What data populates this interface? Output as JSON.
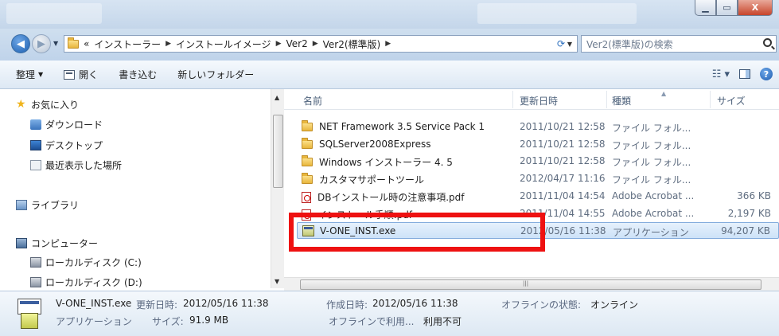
{
  "window": {
    "caption_buttons": [
      "minimize",
      "maximize",
      "close"
    ],
    "close_label": "X"
  },
  "address": {
    "overflow": "«",
    "crumbs": [
      "インストーラー",
      "インストールイメージ",
      "Ver2",
      "Ver2(標準版)"
    ],
    "search_placeholder": "Ver2(標準版)の検索"
  },
  "toolbar": {
    "organize": "整理",
    "open": "開く",
    "burn": "書き込む",
    "new_folder": "新しいフォルダー"
  },
  "nav": {
    "favorites": "お気に入り",
    "downloads": "ダウンロード",
    "desktop": "デスクトップ",
    "recent": "最近表示した場所",
    "libraries": "ライブラリ",
    "computer": "コンピューター",
    "local_c": "ローカルディスク (C:)",
    "local_d": "ローカルディスク (D:)"
  },
  "columns": {
    "name": "名前",
    "date": "更新日時",
    "type": "種類",
    "size": "サイズ"
  },
  "files": [
    {
      "name": "NET Framework 3.5 Service Pack 1",
      "date": "2011/10/21 12:58",
      "type": "ファイル フォル...",
      "size": "",
      "icon": "folder-icon"
    },
    {
      "name": "SQLServer2008Express",
      "date": "2011/10/21 12:58",
      "type": "ファイル フォル...",
      "size": "",
      "icon": "folder-icon"
    },
    {
      "name": "Windows インストーラー 4. 5",
      "date": "2011/10/21 12:58",
      "type": "ファイル フォル...",
      "size": "",
      "icon": "folder-icon"
    },
    {
      "name": "カスタマサポートツール",
      "date": "2012/04/17 11:16",
      "type": "ファイル フォル...",
      "size": "",
      "icon": "folder-icon"
    },
    {
      "name": "DBインストール時の注意事項.pdf",
      "date": "2011/11/04 14:54",
      "type": "Adobe Acrobat ...",
      "size": "366 KB",
      "icon": "pdf-icon"
    },
    {
      "name": "インストール手順.pdf",
      "date": "2011/11/04 14:55",
      "type": "Adobe Acrobat ...",
      "size": "2,197 KB",
      "icon": "pdf-icon"
    },
    {
      "name": "V-ONE_INST.exe",
      "date": "2012/05/16 11:38",
      "type": "アプリケーション",
      "size": "94,207 KB",
      "icon": "exe-icon",
      "selected": true
    }
  ],
  "details": {
    "filename": "V-ONE_INST.exe",
    "modified_label": "更新日時:",
    "modified": "2012/05/16 11:38",
    "created_label": "作成日時:",
    "created": "2012/05/16 11:38",
    "offline_status_label": "オフラインの状態:",
    "offline_status": "オンライン",
    "type": "アプリケーション",
    "size_label": "サイズ:",
    "size": "91.9 MB",
    "offline_avail_label": "オフラインで利用...",
    "offline_avail": "利用不可"
  },
  "colors": {
    "highlight_box": "#ee1111",
    "selection": "#cde2f8"
  }
}
